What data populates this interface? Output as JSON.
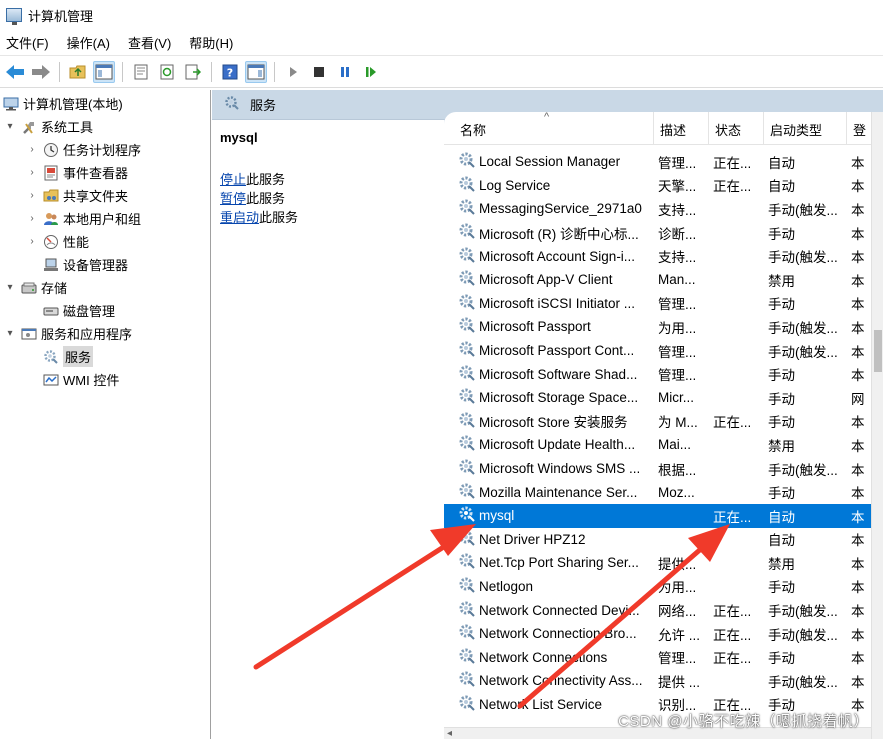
{
  "window": {
    "title": "计算机管理"
  },
  "menu": [
    {
      "label": "文件(F)"
    },
    {
      "label": "操作(A)"
    },
    {
      "label": "查看(V)"
    },
    {
      "label": "帮助(H)"
    }
  ],
  "tree": {
    "root": "计算机管理(本地)",
    "items": [
      {
        "label": "系统工具"
      },
      {
        "label": "任务计划程序"
      },
      {
        "label": "事件查看器"
      },
      {
        "label": "共享文件夹"
      },
      {
        "label": "本地用户和组"
      },
      {
        "label": "性能"
      },
      {
        "label": "设备管理器"
      },
      {
        "label": "存储"
      },
      {
        "label": "磁盘管理"
      },
      {
        "label": "服务和应用程序"
      },
      {
        "label": "服务"
      },
      {
        "label": "WMI 控件"
      }
    ]
  },
  "services_header": {
    "title": "服务"
  },
  "detail": {
    "service_name": "mysql",
    "actions": [
      {
        "link": "停止",
        "suffix": "此服务"
      },
      {
        "link": "暂停",
        "suffix": "此服务"
      },
      {
        "link": "重启动",
        "suffix": "此服务"
      }
    ]
  },
  "columns": {
    "name": "名称",
    "desc": "描述",
    "status": "状态",
    "startup": "启动类型",
    "logon": "登"
  },
  "services": [
    {
      "name": "Local Session Manager",
      "desc": "管理...",
      "status": "正在...",
      "startup": "自动",
      "logon": "本"
    },
    {
      "name": "Log Service",
      "desc": "天擎...",
      "status": "正在...",
      "startup": "自动",
      "logon": "本"
    },
    {
      "name": "MessagingService_2971a0",
      "desc": "支持...",
      "status": "",
      "startup": "手动(触发...",
      "logon": "本"
    },
    {
      "name": "Microsoft (R) 诊断中心标...",
      "desc": "诊断...",
      "status": "",
      "startup": "手动",
      "logon": "本"
    },
    {
      "name": "Microsoft Account Sign-i...",
      "desc": "支持...",
      "status": "",
      "startup": "手动(触发...",
      "logon": "本"
    },
    {
      "name": "Microsoft App-V Client",
      "desc": "Man...",
      "status": "",
      "startup": "禁用",
      "logon": "本"
    },
    {
      "name": "Microsoft iSCSI Initiator ...",
      "desc": "管理...",
      "status": "",
      "startup": "手动",
      "logon": "本"
    },
    {
      "name": "Microsoft Passport",
      "desc": "为用...",
      "status": "",
      "startup": "手动(触发...",
      "logon": "本"
    },
    {
      "name": "Microsoft Passport Cont...",
      "desc": "管理...",
      "status": "",
      "startup": "手动(触发...",
      "logon": "本"
    },
    {
      "name": "Microsoft Software Shad...",
      "desc": "管理...",
      "status": "",
      "startup": "手动",
      "logon": "本"
    },
    {
      "name": "Microsoft Storage Space...",
      "desc": "Micr...",
      "status": "",
      "startup": "手动",
      "logon": "网"
    },
    {
      "name": "Microsoft Store 安装服务",
      "desc": "为 M...",
      "status": "正在...",
      "startup": "手动",
      "logon": "本"
    },
    {
      "name": "Microsoft Update Health...",
      "desc": "Mai...",
      "status": "",
      "startup": "禁用",
      "logon": "本"
    },
    {
      "name": "Microsoft Windows SMS ...",
      "desc": "根据...",
      "status": "",
      "startup": "手动(触发...",
      "logon": "本"
    },
    {
      "name": "Mozilla Maintenance Ser...",
      "desc": "Moz...",
      "status": "",
      "startup": "手动",
      "logon": "本"
    },
    {
      "name": "mysql",
      "desc": "",
      "status": "正在...",
      "startup": "自动",
      "logon": "本"
    },
    {
      "name": "Net Driver HPZ12",
      "desc": "",
      "status": "",
      "startup": "自动",
      "logon": "本"
    },
    {
      "name": "Net.Tcp Port Sharing Ser...",
      "desc": "提供...",
      "status": "",
      "startup": "禁用",
      "logon": "本"
    },
    {
      "name": "Netlogon",
      "desc": "为用...",
      "status": "",
      "startup": "手动",
      "logon": "本"
    },
    {
      "name": "Network Connected Devi...",
      "desc": "网络...",
      "status": "正在...",
      "startup": "手动(触发...",
      "logon": "本"
    },
    {
      "name": "Network Connection Bro...",
      "desc": "允许 ...",
      "status": "正在...",
      "startup": "手动(触发...",
      "logon": "本"
    },
    {
      "name": "Network Connections",
      "desc": "管理...",
      "status": "正在...",
      "startup": "手动",
      "logon": "本"
    },
    {
      "name": "Network Connectivity Ass...",
      "desc": "提供 ...",
      "status": "",
      "startup": "手动(触发...",
      "logon": "本"
    },
    {
      "name": "Network List Service",
      "desc": "识别...",
      "status": "正在...",
      "startup": "手动",
      "logon": "本"
    }
  ],
  "selected_service": "mysql",
  "watermark": "CSDN @小骆不吃辣（嗯抓挠着帆）",
  "colors": {
    "selection": "#0078d7",
    "header": "#c9d8e6",
    "annotation_arrow": "#f03a2a"
  }
}
